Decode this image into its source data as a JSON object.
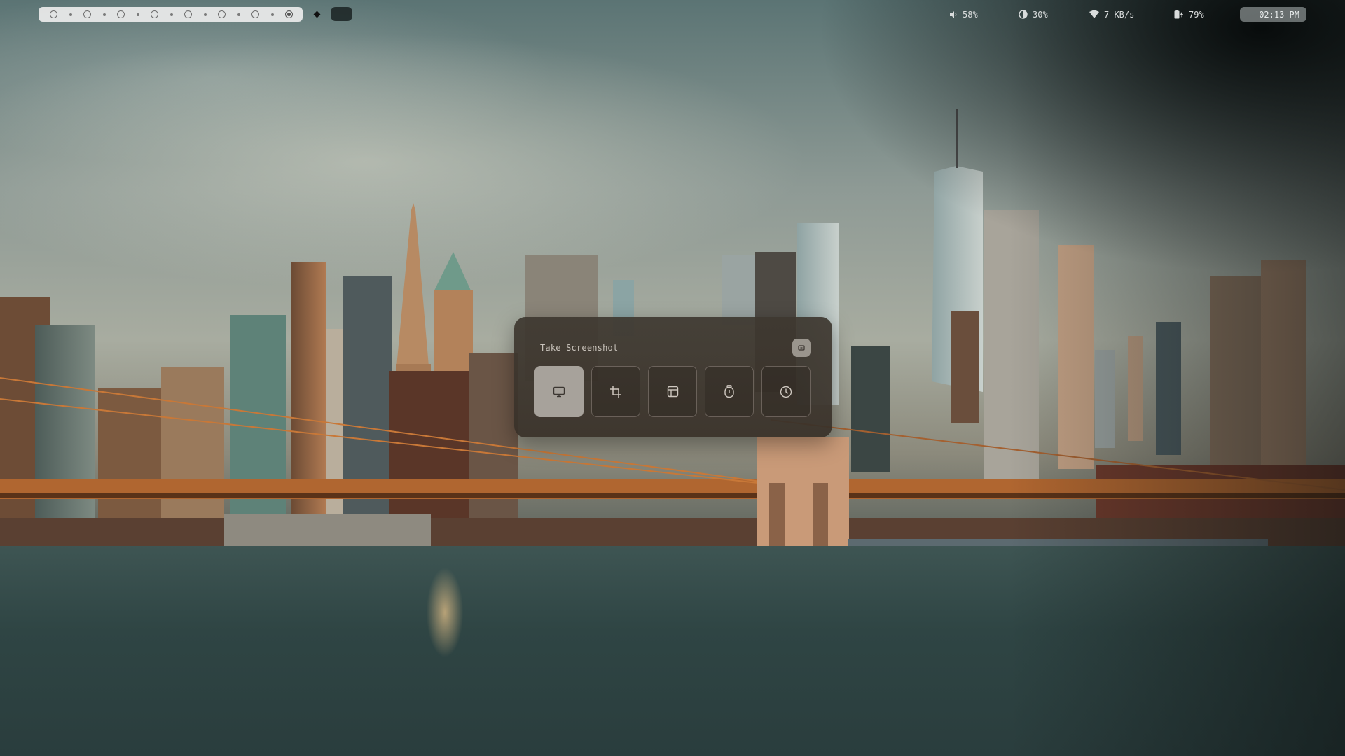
{
  "topbar": {
    "workspaces": {
      "count": 8,
      "active_index": 7
    },
    "status": {
      "volume": {
        "icon": "speaker-icon",
        "value": "58%"
      },
      "brightness": {
        "icon": "brightness-icon",
        "value": "30%"
      },
      "network": {
        "icon": "wifi-icon",
        "value": "7 KB/s"
      },
      "battery": {
        "icon": "battery-charging-icon",
        "value": "79%"
      }
    },
    "clock": "02:13 PM"
  },
  "screenshot_panel": {
    "title": "Take Screenshot",
    "close_icon": "close-icon",
    "modes": [
      {
        "id": "screen",
        "icon": "monitor-icon",
        "selected": true
      },
      {
        "id": "region",
        "icon": "crop-icon",
        "selected": false
      },
      {
        "id": "window",
        "icon": "window-icon",
        "selected": false
      },
      {
        "id": "timer",
        "icon": "stopwatch-icon",
        "selected": false
      },
      {
        "id": "delay",
        "icon": "clock-icon",
        "selected": false
      }
    ]
  },
  "colors": {
    "panel_bg": "#3e3830",
    "selected_button": "#a7a29b",
    "bar_text": "#d9dcdc"
  }
}
